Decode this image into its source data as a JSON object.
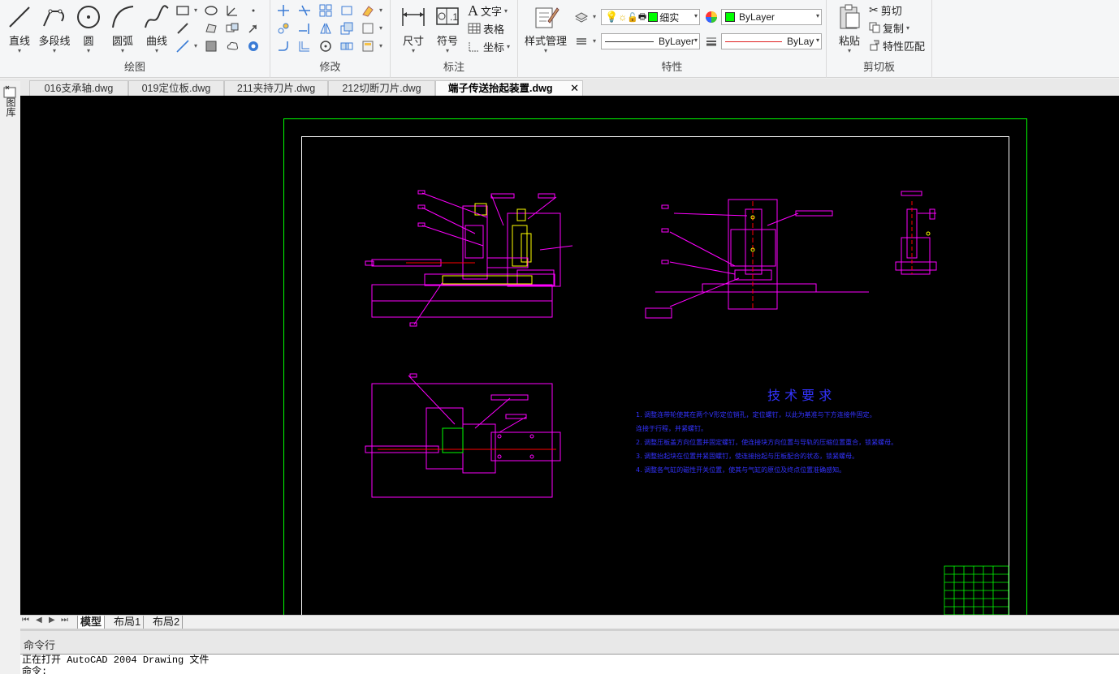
{
  "ribbon": {
    "panels": {
      "draw": "绘图",
      "modify": "修改",
      "annotate": "标注",
      "properties": "特性",
      "clipboard": "剪切板"
    },
    "draw_buttons": {
      "line": "直线",
      "polyline": "多段线",
      "circle": "圆",
      "arc": "圆弧",
      "curve": "曲线"
    },
    "annotate_buttons": {
      "dimension": "尺寸",
      "symbol": "符号",
      "text": "文字",
      "table": "表格",
      "coordinate": "坐标"
    },
    "style_manager": "样式管理",
    "layer_combo": "细实",
    "color_combo": "ByLayer",
    "linetype_combo": "ByLayer",
    "lineweight_combo": "ByLay",
    "colors": {
      "layer_swatch": "#00ff00",
      "accent_line": "#e02020"
    },
    "clipboard": {
      "paste": "粘贴",
      "cut": "剪切",
      "copy": "复制",
      "match_properties": "特性匹配"
    }
  },
  "doc_tabs": [
    {
      "label": "016支承轴.dwg"
    },
    {
      "label": "019定位板.dwg"
    },
    {
      "label": "211夹持刀片.dwg"
    },
    {
      "label": "212切断刀片.dwg"
    },
    {
      "label": "端子传送抬起装置.dwg",
      "active": true
    }
  ],
  "left_strip_label": "图库",
  "drawing": {
    "tech_title": "技 术 要 求",
    "tech_notes": [
      "1. 调整连带轮使其在两个V形定位销孔，定位螺钉，以此为基准与下方连接件固定。",
      "    连接于行程，并紧螺钉。",
      "2. 调整压板盖方向位置并固定螺钉，使连接块方向位置与导轨的压缩位置重合，锁紧螺母。",
      "3. 调整抬起块在位置并紧固螺钉，使连接抬起与压板配合的状态，锁紧螺母。",
      "4. 调整各气缸的磁性开关位置，使其与气缸的原位及终点位置准确感知。"
    ],
    "colors": {
      "outer_frame": "#00ff00",
      "inner_frame": "#ffffff",
      "geometry": "#ff00ff",
      "highlight": "#ffff00",
      "text": "#3333ff",
      "centerline": "#ff0000"
    }
  },
  "layout_tabs": [
    "模型",
    "布局1",
    "布局2"
  ],
  "command": {
    "header": "命令行",
    "lines": [
      "正在打开 AutoCAD 2004 Drawing 文件",
      "命令:"
    ]
  }
}
